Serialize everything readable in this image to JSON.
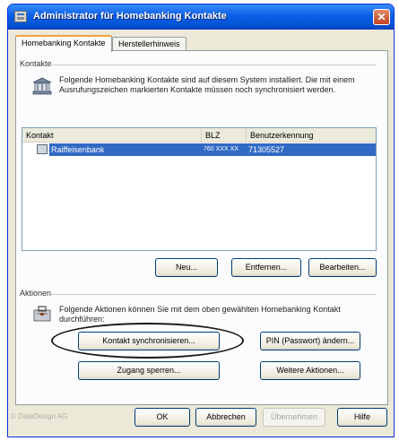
{
  "window": {
    "title": "Administrator für Homebanking Kontakte",
    "close_glyph": "✕"
  },
  "tabs": [
    {
      "label": "Homebanking Kontakte",
      "active": true
    },
    {
      "label": "Herstellerhinweis",
      "active": false
    }
  ],
  "contacts_group": {
    "label": "Kontakte",
    "description": "Folgende Homebanking Kontakte sind auf diesem System installiert. Die mit einem Ausrufungszeichen markierten Kontakte müssen noch synchronisiert werden.",
    "icon": "bank-building-icon"
  },
  "table": {
    "columns": [
      "Kontakt",
      "BLZ",
      "Benutzerkennung"
    ],
    "rows": [
      {
        "kontakt": "Raiffeisenbank",
        "blz": "760 XXX XX",
        "benutzerkennung": "71305527",
        "selected": true
      }
    ]
  },
  "list_buttons": {
    "new": "Neu...",
    "remove": "Entfernen...",
    "edit": "Bearbeiten..."
  },
  "actions_group": {
    "label": "Aktionen",
    "description": "Folgende Aktionen können Sie mit dem oben gewählten Homebanking Kontakt durchführen:",
    "icon": "tools-icon",
    "buttons": {
      "sync": "Kontakt synchronisieren...",
      "change_pin": "PIN (Passwort) ändern...",
      "lock_access": "Zugang sperren...",
      "more_actions": "Weitere Aktionen..."
    }
  },
  "footer": {
    "brand": "© DataDesign AG",
    "ok": "OK",
    "cancel": "Abbrechen",
    "apply": "Übernehmen",
    "help": "Hilfe"
  }
}
